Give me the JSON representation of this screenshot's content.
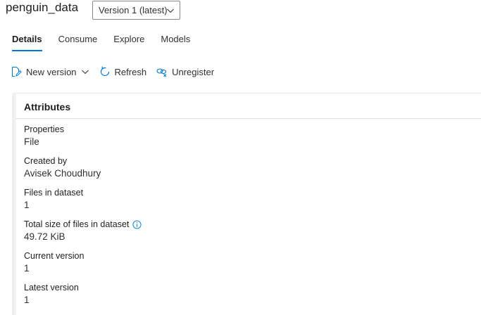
{
  "header": {
    "title": "penguin_data",
    "version_select": "Version 1 (latest)"
  },
  "tabs": [
    {
      "label": "Details",
      "active": true
    },
    {
      "label": "Consume",
      "active": false
    },
    {
      "label": "Explore",
      "active": false
    },
    {
      "label": "Models",
      "active": false
    }
  ],
  "toolbar": {
    "new_version": "New version",
    "refresh": "Refresh",
    "unregister": "Unregister"
  },
  "attributes": {
    "title": "Attributes",
    "properties_label": "Properties",
    "properties_value": "File",
    "created_by_label": "Created by",
    "created_by_value": "Avisek Choudhury",
    "files_label": "Files in dataset",
    "files_value": "1",
    "total_size_label": "Total size of files in dataset",
    "total_size_value": "49.72 KiB",
    "current_version_label": "Current version",
    "current_version_value": "1",
    "latest_version_label": "Latest version",
    "latest_version_value": "1"
  },
  "colors": {
    "accent": "#0078d4",
    "text": "#201f1e"
  }
}
